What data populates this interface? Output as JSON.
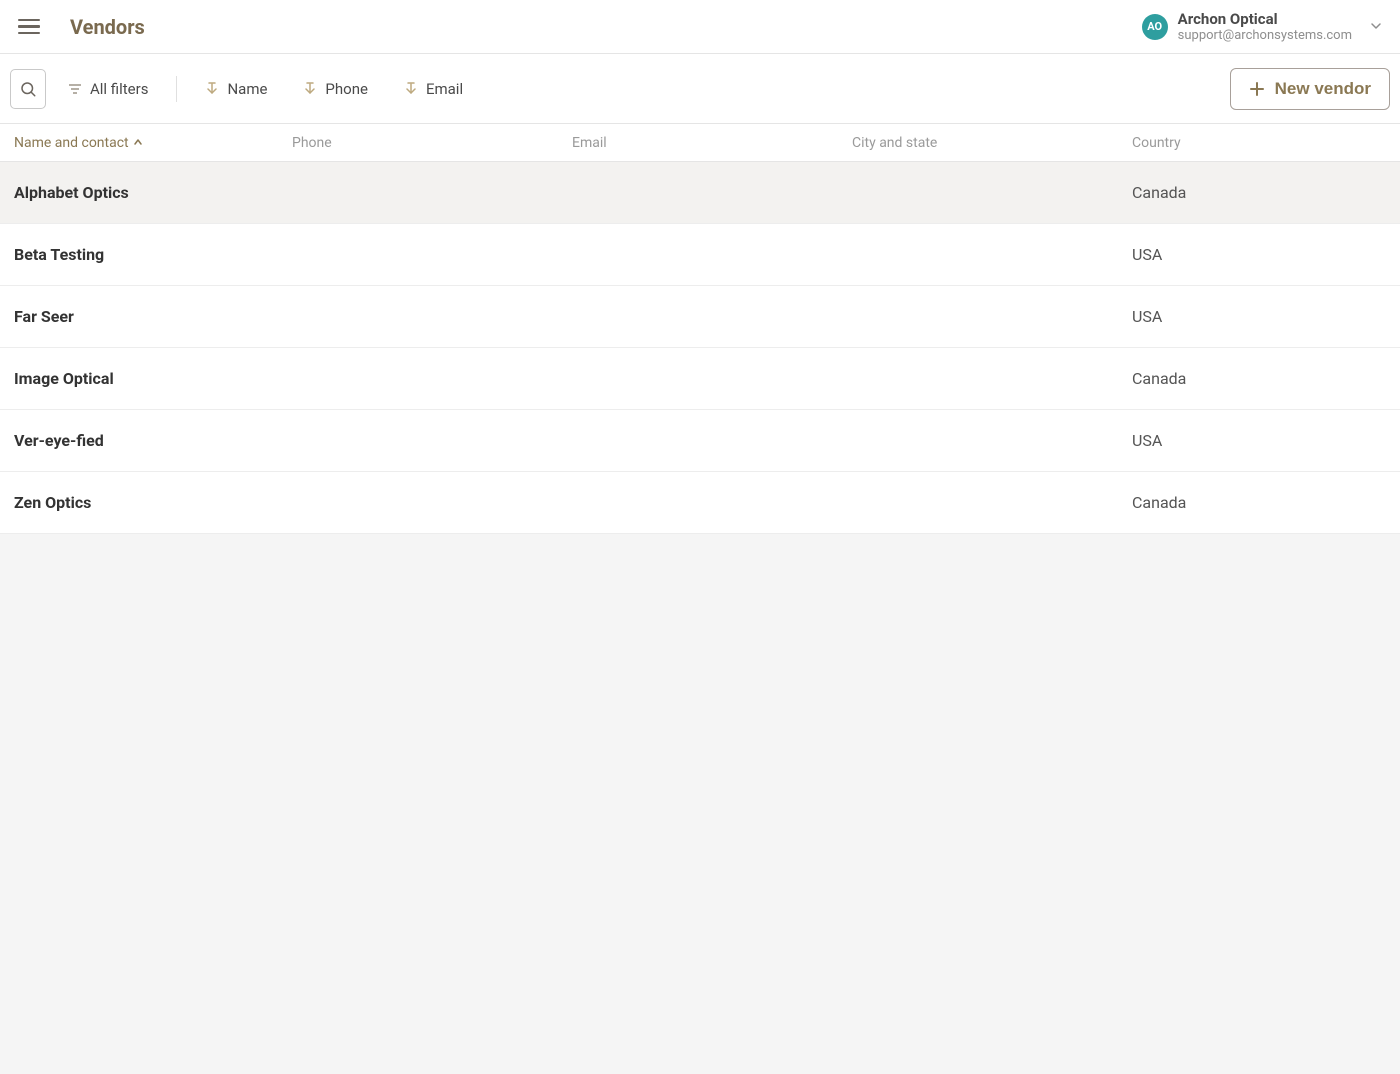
{
  "header": {
    "page_title": "Vendors",
    "account": {
      "avatar_initials": "AO",
      "name": "Archon Optical",
      "email": "support@archonsystems.com"
    }
  },
  "toolbar": {
    "all_filters": "All filters",
    "filters": [
      "Name",
      "Phone",
      "Email"
    ],
    "new_vendor": "New vendor"
  },
  "table": {
    "columns": {
      "name": "Name and contact",
      "phone": "Phone",
      "email": "Email",
      "city": "City and state",
      "country": "Country"
    },
    "rows": [
      {
        "name": "Alphabet Optics",
        "phone": "",
        "email": "",
        "city": "",
        "country": "Canada"
      },
      {
        "name": "Beta Testing",
        "phone": "",
        "email": "",
        "city": "",
        "country": "USA"
      },
      {
        "name": "Far Seer",
        "phone": "",
        "email": "",
        "city": "",
        "country": "USA"
      },
      {
        "name": "Image Optical",
        "phone": "",
        "email": "",
        "city": "",
        "country": "Canada"
      },
      {
        "name": "Ver-eye-fied",
        "phone": "",
        "email": "",
        "city": "",
        "country": "USA"
      },
      {
        "name": "Zen Optics",
        "phone": "",
        "email": "",
        "city": "",
        "country": "Canada"
      }
    ]
  }
}
